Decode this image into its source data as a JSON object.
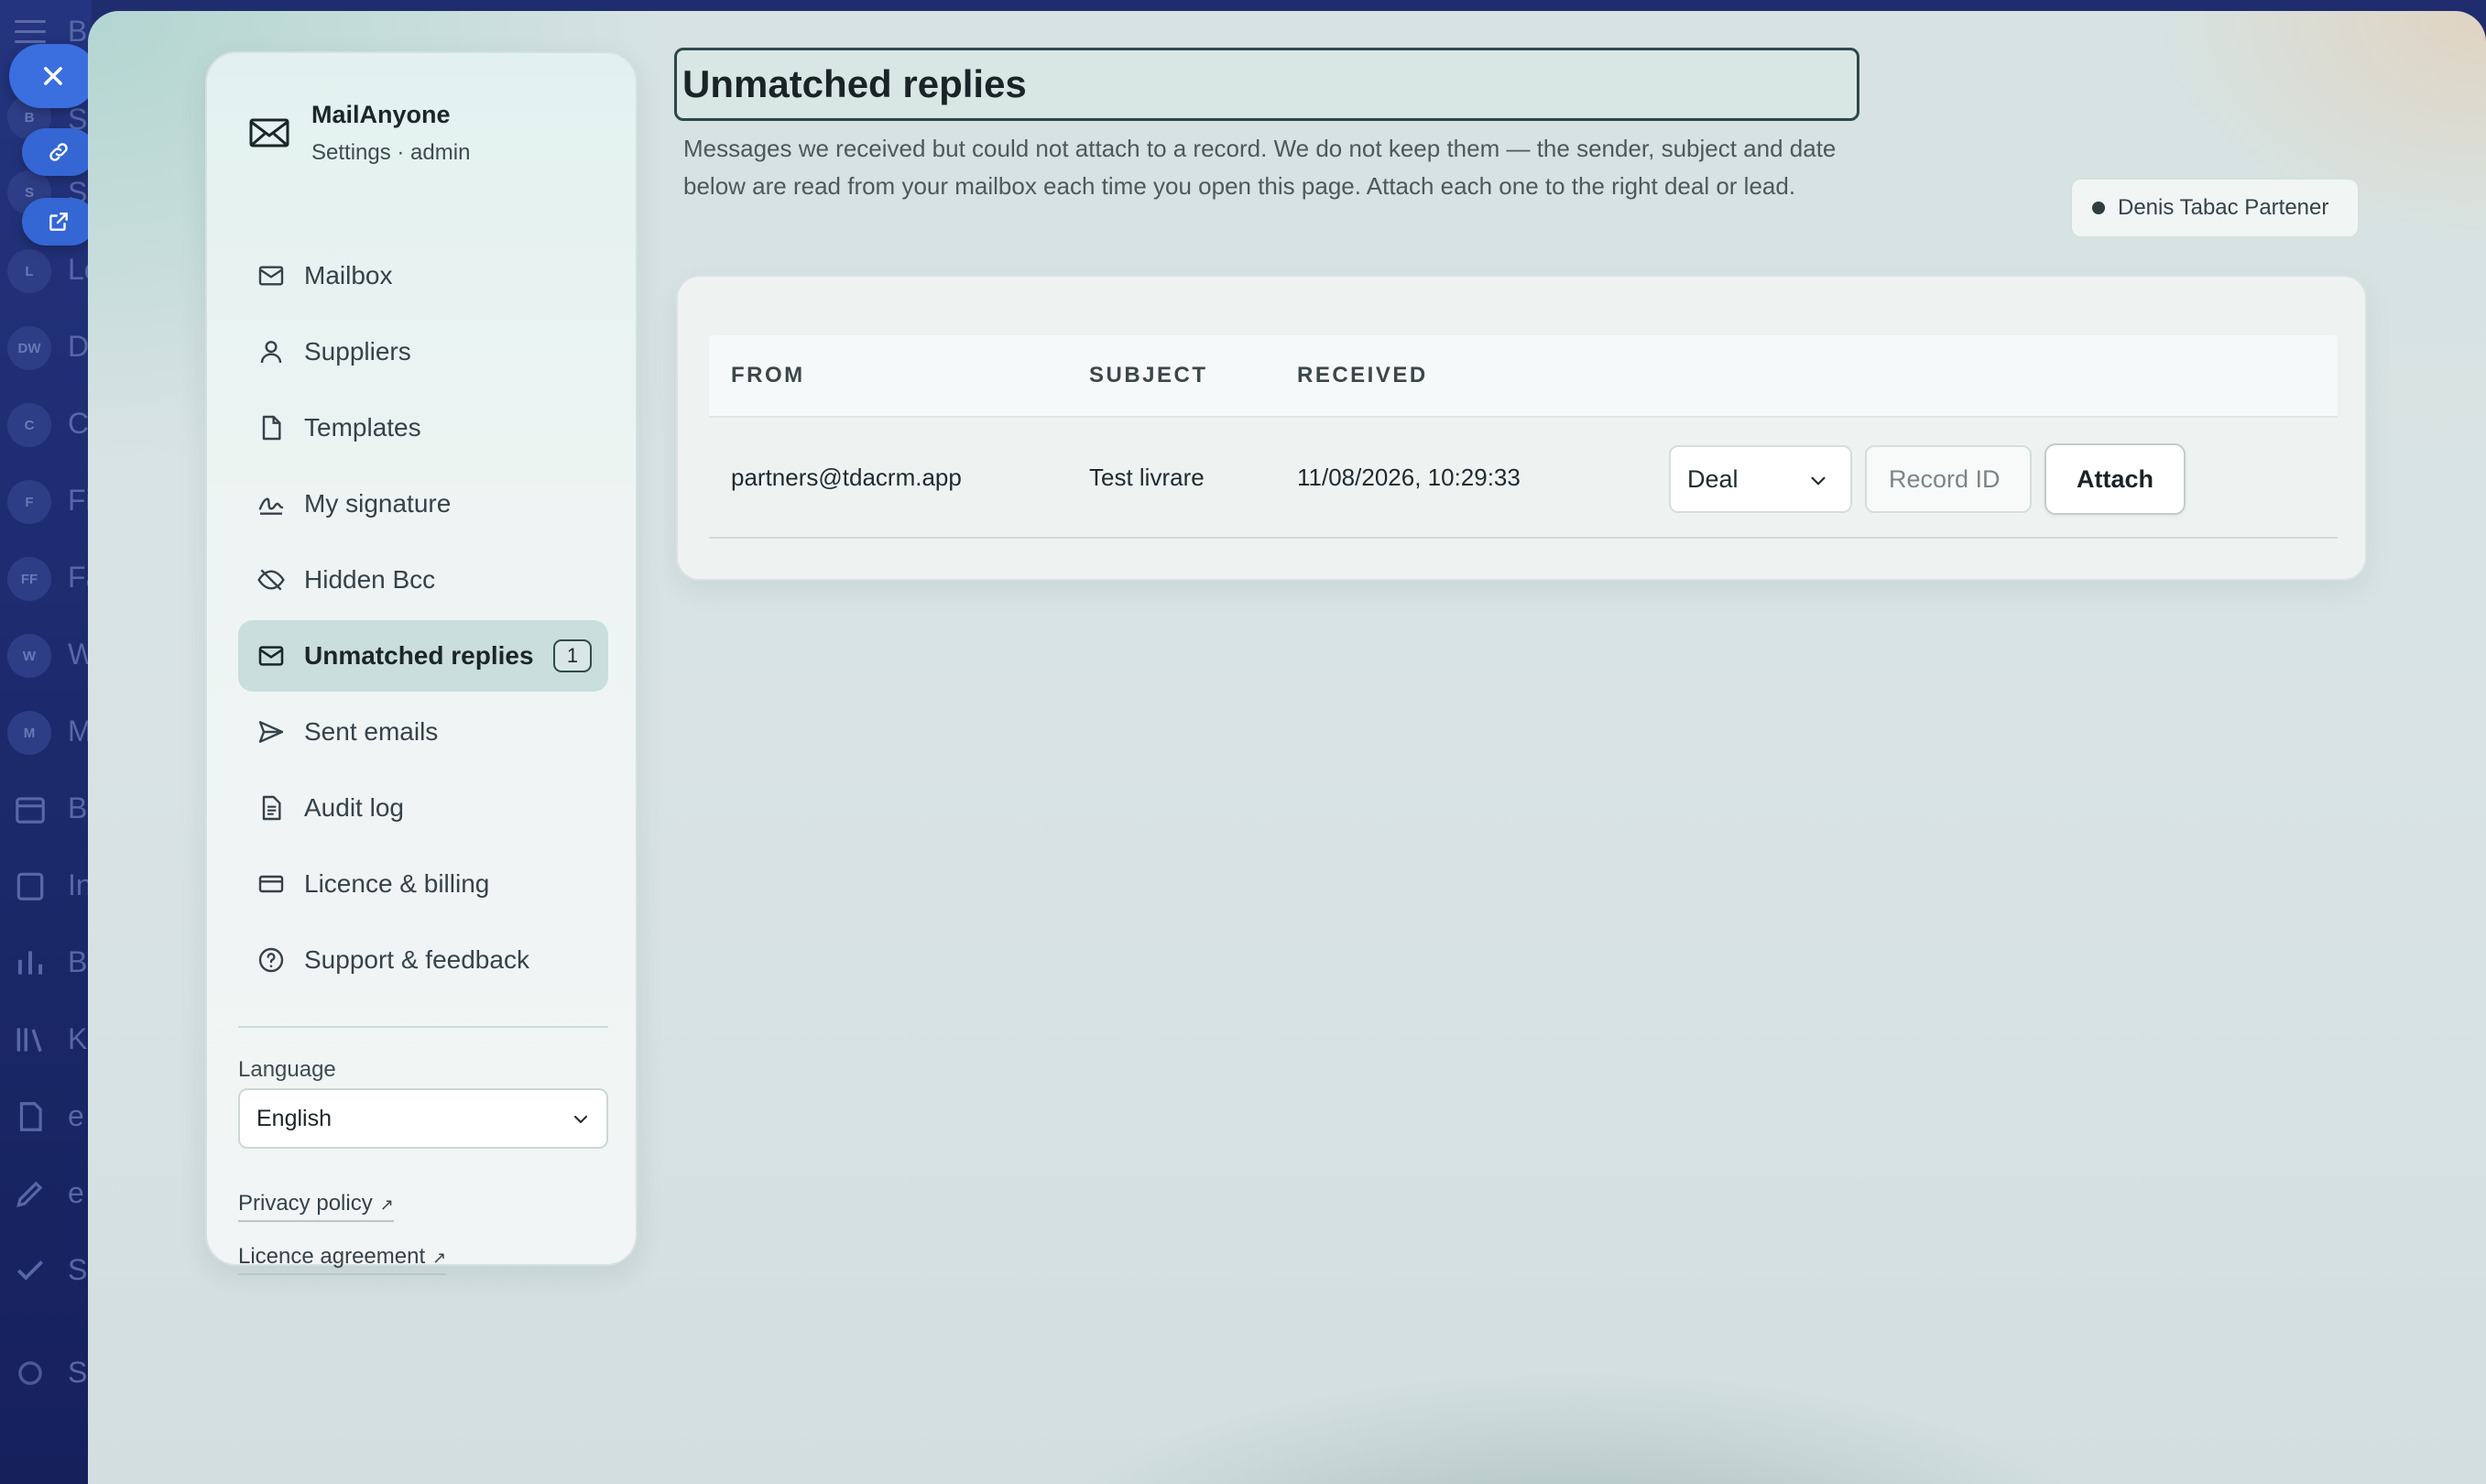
{
  "host": {
    "rail_items": [
      "B",
      "S",
      "L",
      "DW",
      "C",
      "F",
      "FF",
      "W",
      "M"
    ],
    "rail_text": [
      "B",
      "S",
      "S",
      "Lo",
      "D",
      "C",
      "Fi",
      "Fa",
      "W",
      "M",
      "B",
      "In",
      "B",
      "K",
      "e",
      "e",
      "S",
      "S"
    ]
  },
  "sidebar": {
    "brand_name": "MailAnyone",
    "brand_sub": "Settings · admin",
    "items": [
      {
        "label": "Mailbox",
        "icon": "mail-icon"
      },
      {
        "label": "Suppliers",
        "icon": "person-icon"
      },
      {
        "label": "Templates",
        "icon": "document-icon"
      },
      {
        "label": "My signature",
        "icon": "signature-icon"
      },
      {
        "label": "Hidden Bcc",
        "icon": "eye-off-icon"
      },
      {
        "label": "Unmatched replies",
        "icon": "mail-icon",
        "active": true,
        "badge": "1"
      },
      {
        "label": "Sent emails",
        "icon": "send-icon"
      },
      {
        "label": "Audit log",
        "icon": "log-icon"
      },
      {
        "label": "Licence & billing",
        "icon": "card-icon"
      },
      {
        "label": "Support & feedback",
        "icon": "help-icon"
      }
    ],
    "language_label": "Language",
    "language_value": "English",
    "privacy_link": "Privacy policy",
    "licence_link": "Licence agreement"
  },
  "main": {
    "title": "Unmatched replies",
    "description": "Messages we received but could not attach to a record. We do not keep them — the sender, subject and date below are read from your mailbox each time you open this page. Attach each one to the right deal or lead.",
    "user_chip": "Denis Tabac Partener",
    "table": {
      "headers": [
        "FROM",
        "SUBJECT",
        "RECEIVED"
      ],
      "rows": [
        {
          "from": "partners@tdacrm.app",
          "subject": "Test livrare",
          "received": "11/08/2026, 10:29:33",
          "type_value": "Deal",
          "record_placeholder": "Record ID",
          "attach_label": "Attach"
        }
      ]
    }
  },
  "colors": {
    "accent": "#2d4848",
    "active_nav": "#c9dedd",
    "host_rail": "#1f2d6e",
    "float_button": "#3b6fe0"
  }
}
